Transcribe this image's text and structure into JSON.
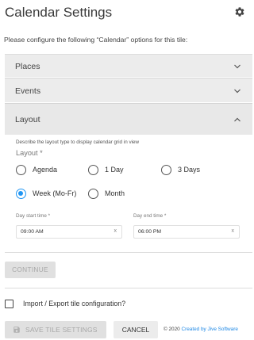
{
  "header": {
    "title": "Calendar Settings",
    "settings_icon": "gear-icon"
  },
  "intro_text": "Please configure the following “Calendar” options for this tile:",
  "sections": {
    "places": {
      "label": "Places",
      "state": "collapsed"
    },
    "events": {
      "label": "Events",
      "state": "collapsed"
    },
    "layout": {
      "label": "Layout",
      "state": "expanded"
    }
  },
  "layout": {
    "helper_text": "Describe the layout type to display calendar grid in view",
    "group_label": "Layout *",
    "options": [
      {
        "label": "Agenda",
        "selected": false
      },
      {
        "label": "1 Day",
        "selected": false
      },
      {
        "label": "3 Days",
        "selected": false
      },
      {
        "label": "Week (Mo-Fr)",
        "selected": true
      },
      {
        "label": "Month",
        "selected": false
      }
    ],
    "day_start": {
      "label": "Day start time *",
      "value": "09:00 AM",
      "clear": "x"
    },
    "day_end": {
      "label": "Day end time *",
      "value": "06:00 PM",
      "clear": "x"
    }
  },
  "continue_label": "CONTINUE",
  "import_export_label": "Import / Export tile configuration?",
  "footer": {
    "save_label": "SAVE TILE SETTINGS",
    "cancel_label": "CANCEL",
    "copyright": "© 2020",
    "credit_link": "Created by Jive Software"
  },
  "colors": {
    "accent": "#2196f3",
    "section_bg": "#ececec",
    "disabled_button_bg": "#e0e0e0",
    "link": "#1e88e5"
  }
}
